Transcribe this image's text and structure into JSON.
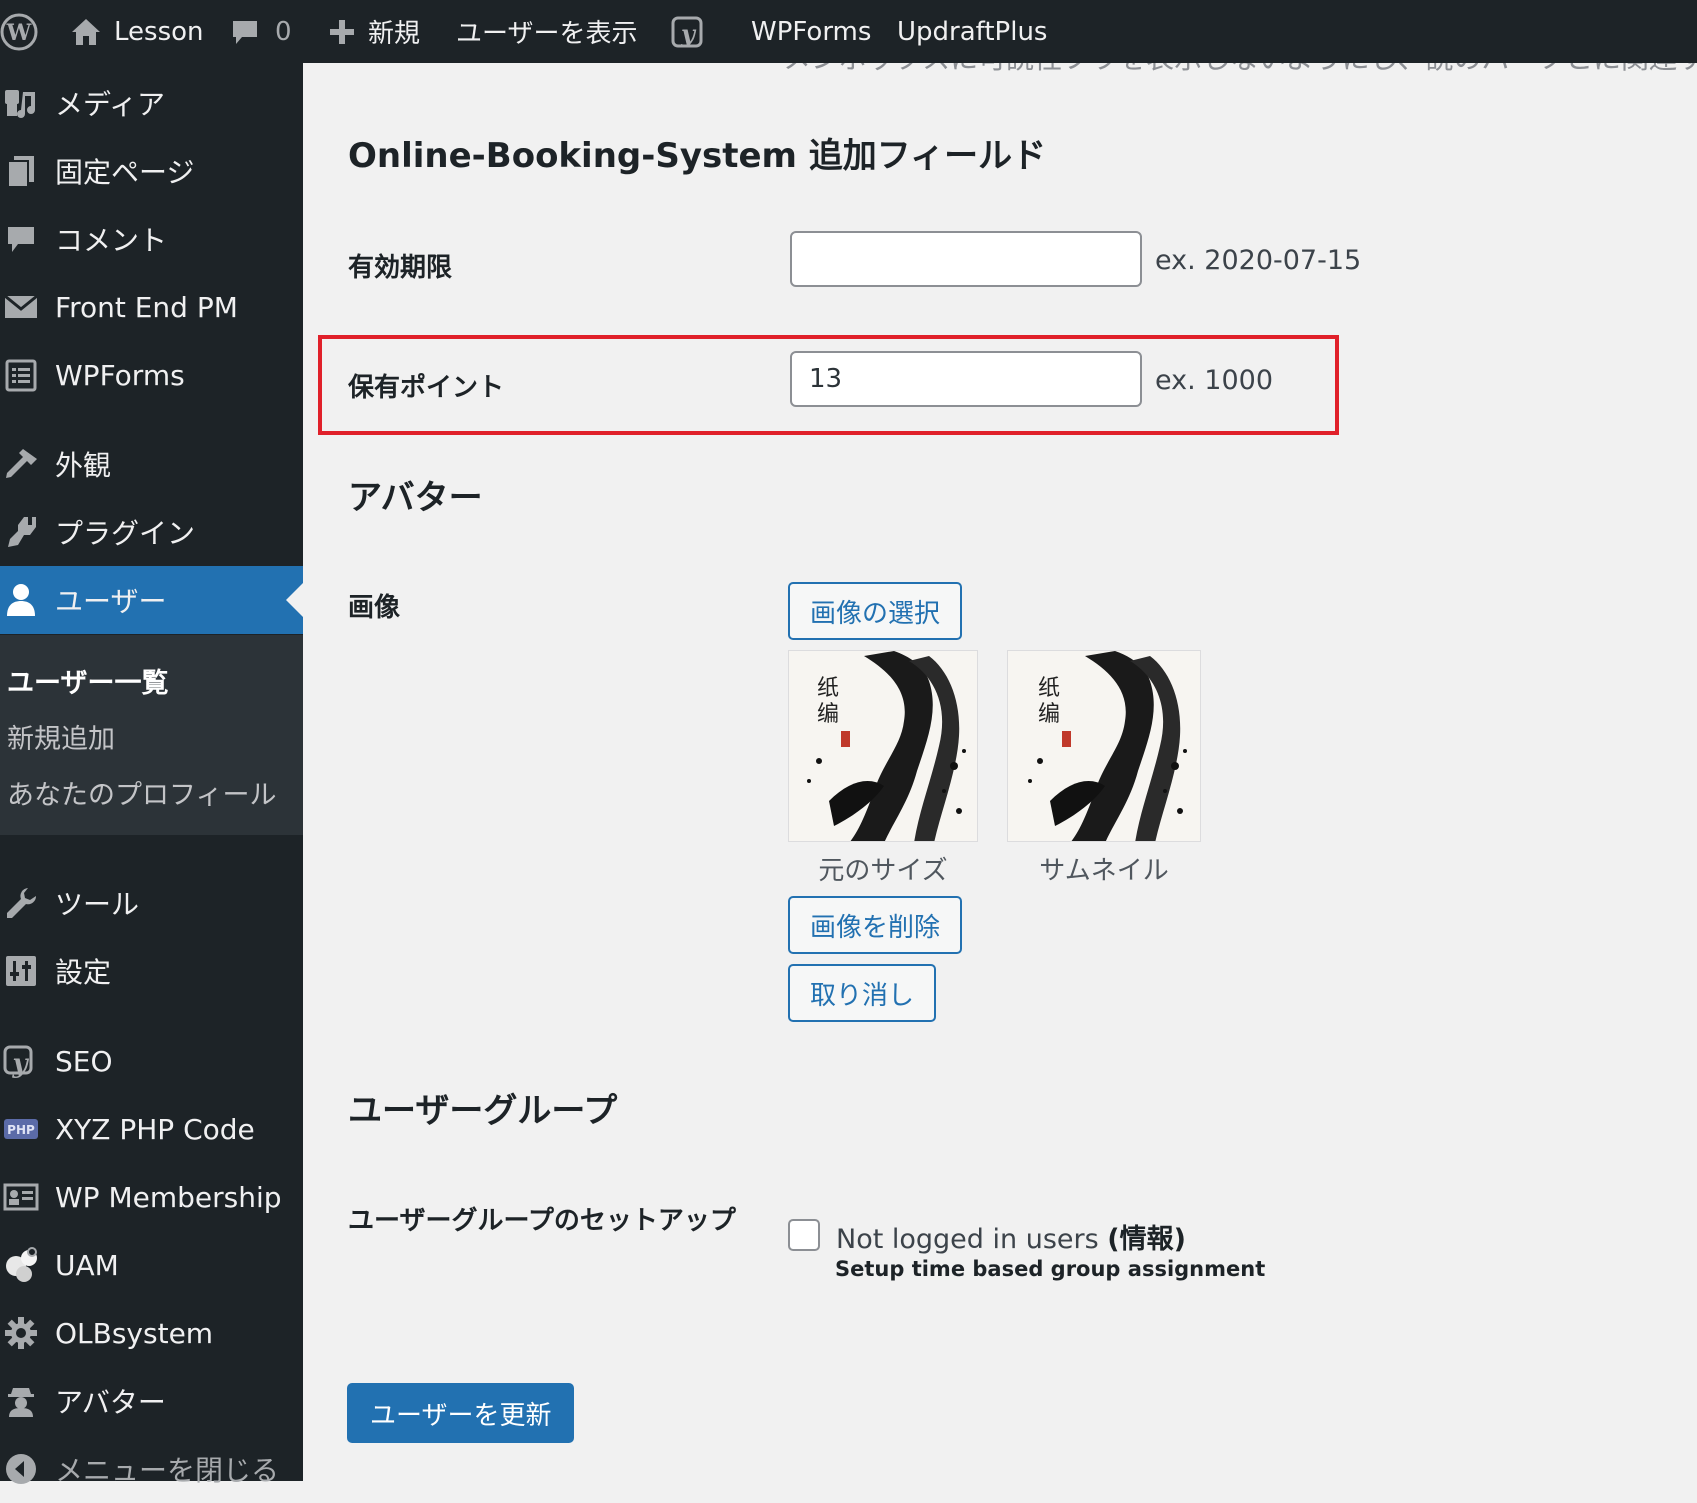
{
  "adminbar": {
    "site_name": "Lesson",
    "comments_count": "0",
    "new_label": "新規",
    "view_user_label": "ユーザーを表示",
    "wpforms_label": "WPForms",
    "updraft_label": "UpdraftPlus"
  },
  "sidebar": {
    "items": [
      {
        "label": "メディア",
        "icon": "media-icon"
      },
      {
        "label": "固定ページ",
        "icon": "pages-icon"
      },
      {
        "label": "コメント",
        "icon": "comments-icon"
      },
      {
        "label": "Front End PM",
        "icon": "envelope-icon"
      },
      {
        "label": "WPForms",
        "icon": "forms-icon"
      },
      {
        "label": "外観",
        "icon": "appearance-icon"
      },
      {
        "label": "プラグイン",
        "icon": "plugins-icon"
      },
      {
        "label": "ユーザー",
        "icon": "users-icon",
        "current": true
      },
      {
        "label": "ツール",
        "icon": "tools-icon"
      },
      {
        "label": "設定",
        "icon": "settings-icon"
      },
      {
        "label": "SEO",
        "icon": "yoast-icon"
      },
      {
        "label": "XYZ PHP Code",
        "icon": "php-icon"
      },
      {
        "label": "WP Membership",
        "icon": "id-card-icon"
      },
      {
        "label": "UAM",
        "icon": "uam-icon"
      },
      {
        "label": "OLBsystem",
        "icon": "gear-icon"
      },
      {
        "label": "アバター",
        "icon": "avatar-icon"
      },
      {
        "label": "メニューを閉じる",
        "icon": "collapse-icon"
      }
    ],
    "submenu": [
      {
        "label": "ユーザー一覧",
        "current": true
      },
      {
        "label": "新規追加"
      },
      {
        "label": "あなたのプロフィール"
      }
    ]
  },
  "main": {
    "cut_text": "メンボックスに可読性フラを表示しないようにし、説のパーツとに関連す",
    "obs_section_title": "Online-Booking-System 追加フィールド",
    "expiry": {
      "label": "有効期限",
      "value": "",
      "hint": "ex. 2020-07-15"
    },
    "points": {
      "label": "保有ポイント",
      "value": "13",
      "hint": "ex. 1000"
    },
    "avatar_section_title": "アバター",
    "image_label": "画像",
    "select_image_button": "画像の選択",
    "caption_original": "元のサイズ",
    "caption_thumbnail": "サムネイル",
    "remove_image_button": "画像を削除",
    "cancel_button": "取り消し",
    "usergroup_section_title": "ユーザーグループ",
    "usergroup_setup_label": "ユーザーグループのセットアップ",
    "not_logged_in_label": "Not logged in users",
    "info_label": "(情報)",
    "time_based_label": "Setup time based group assignment",
    "update_button": "ユーザーを更新"
  },
  "colors": {
    "adminbar_bg": "#1d2327",
    "sidebar_bg": "#1d2327",
    "submenu_bg": "#2c3338",
    "accent": "#2271b1",
    "highlight_border": "#e0202a",
    "content_bg": "#f1f1f1"
  }
}
